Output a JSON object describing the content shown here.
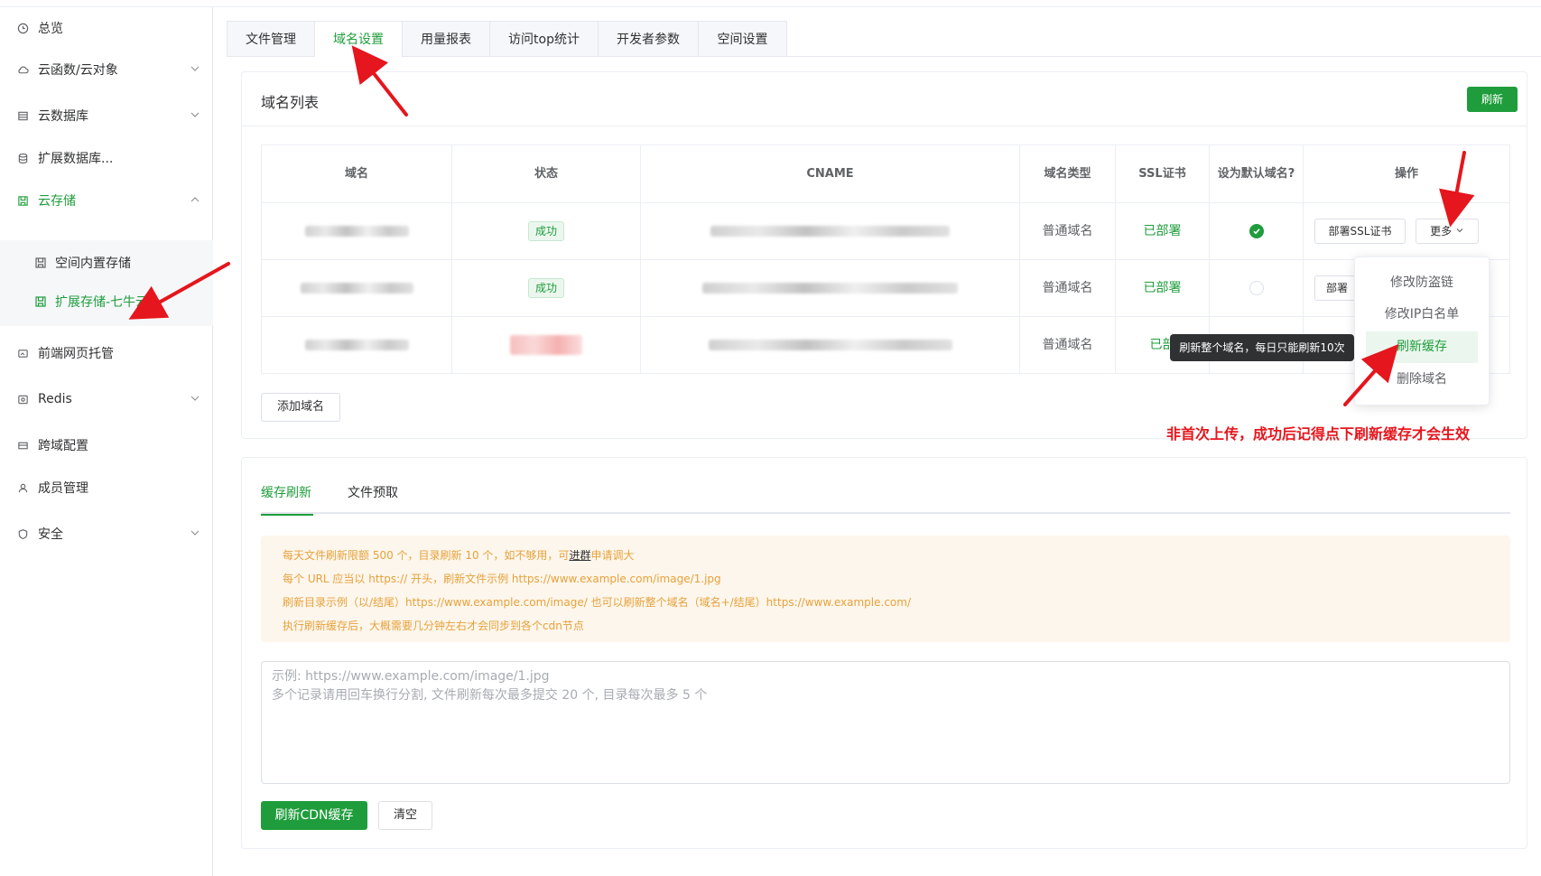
{
  "sidebar": {
    "items": [
      {
        "label": "总览",
        "icon": "clock-icon"
      },
      {
        "label": "云函数/云对象",
        "icon": "cloud-icon"
      },
      {
        "label": "云数据库",
        "icon": "database-icon"
      },
      {
        "label": "扩展数据库...",
        "icon": "stack-icon"
      },
      {
        "label": "云存储",
        "icon": "storage-icon"
      },
      {
        "label": "前端网页托管",
        "icon": "web-icon"
      },
      {
        "label": "Redis",
        "icon": "redis-icon"
      },
      {
        "label": "跨域配置",
        "icon": "cross-icon"
      },
      {
        "label": "成员管理",
        "icon": "user-icon"
      },
      {
        "label": "安全",
        "icon": "shield-icon"
      }
    ],
    "sub_items": [
      {
        "label": "空间内置存储"
      },
      {
        "label": "扩展存储-七牛云"
      }
    ]
  },
  "tabs": [
    "文件管理",
    "域名设置",
    "用量报表",
    "访问top统计",
    "开发者参数",
    "空间设置"
  ],
  "domain_card": {
    "title": "域名列表",
    "refresh_label": "刷新",
    "add_domain_label": "添加域名",
    "columns": [
      "域名",
      "状态",
      "CNAME",
      "域名类型",
      "SSL证书",
      "设为默认域名?",
      "操作"
    ],
    "rows": [
      {
        "status": "成功",
        "type": "普通域名",
        "ssl": "已部署",
        "is_default": true
      },
      {
        "status": "成功",
        "type": "普通域名",
        "ssl": "已部署",
        "is_default": false
      },
      {
        "status": "",
        "type": "普通域名",
        "ssl": "已部署",
        "is_default": false
      }
    ],
    "deploy_ssl_label": "部署SSL证书",
    "deploy_ssl_partial": "部署",
    "more_label": "更多",
    "ssl_partial": "已部"
  },
  "dropdown": {
    "items": [
      "修改防盗链",
      "修改IP白名单",
      "刷新缓存",
      "删除域名"
    ]
  },
  "tooltip": "刷新整个域名，每日只能刷新10次",
  "annotation": "非首次上传，成功后记得点下刷新缓存才会生效",
  "cache_card": {
    "tabs": [
      "缓存刷新",
      "文件预取"
    ],
    "notice": {
      "line1_a": "每天文件刷新限额 500 个，目录刷新 10 个，如不够用，可",
      "line1_link": "进群",
      "line1_b": "申请调大",
      "line2": "每个 URL 应当以 https:// 开头，刷新文件示例 https://www.example.com/image/1.jpg",
      "line3": "刷新目录示例（以/结尾）https://www.example.com/image/ 也可以刷新整个域名（域名+/结尾）https://www.example.com/",
      "line4": "执行刷新缓存后，大概需要几分钟左右才会同步到各个cdn节点"
    },
    "textarea_placeholder": "示例: https://www.example.com/image/1.jpg\n多个记录请用回车换行分割, 文件刷新每次最多提交 20 个, 目录每次最多 5 个",
    "submit_label": "刷新CDN缓存",
    "clear_label": "清空"
  },
  "colors": {
    "brand": "#1f9d3c",
    "warning_text": "#e6a23c",
    "annotation_red": "#e5161d"
  }
}
